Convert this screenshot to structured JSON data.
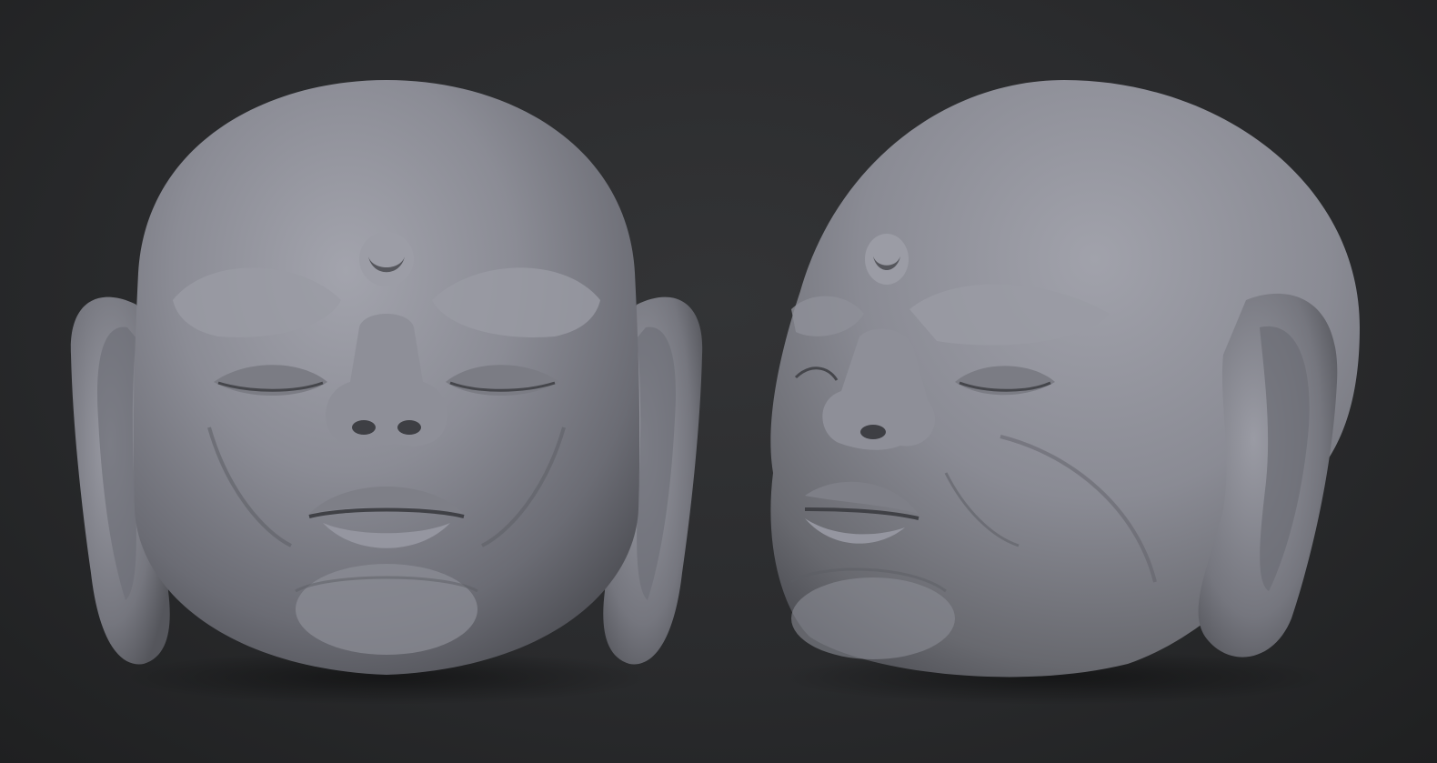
{
  "scene": {
    "background_color": "#2b2c2e",
    "clay_color": "#8a8b93",
    "views": [
      {
        "name": "front-view",
        "subject": "sculpted-head"
      },
      {
        "name": "three-quarter-view",
        "subject": "sculpted-head"
      }
    ]
  }
}
